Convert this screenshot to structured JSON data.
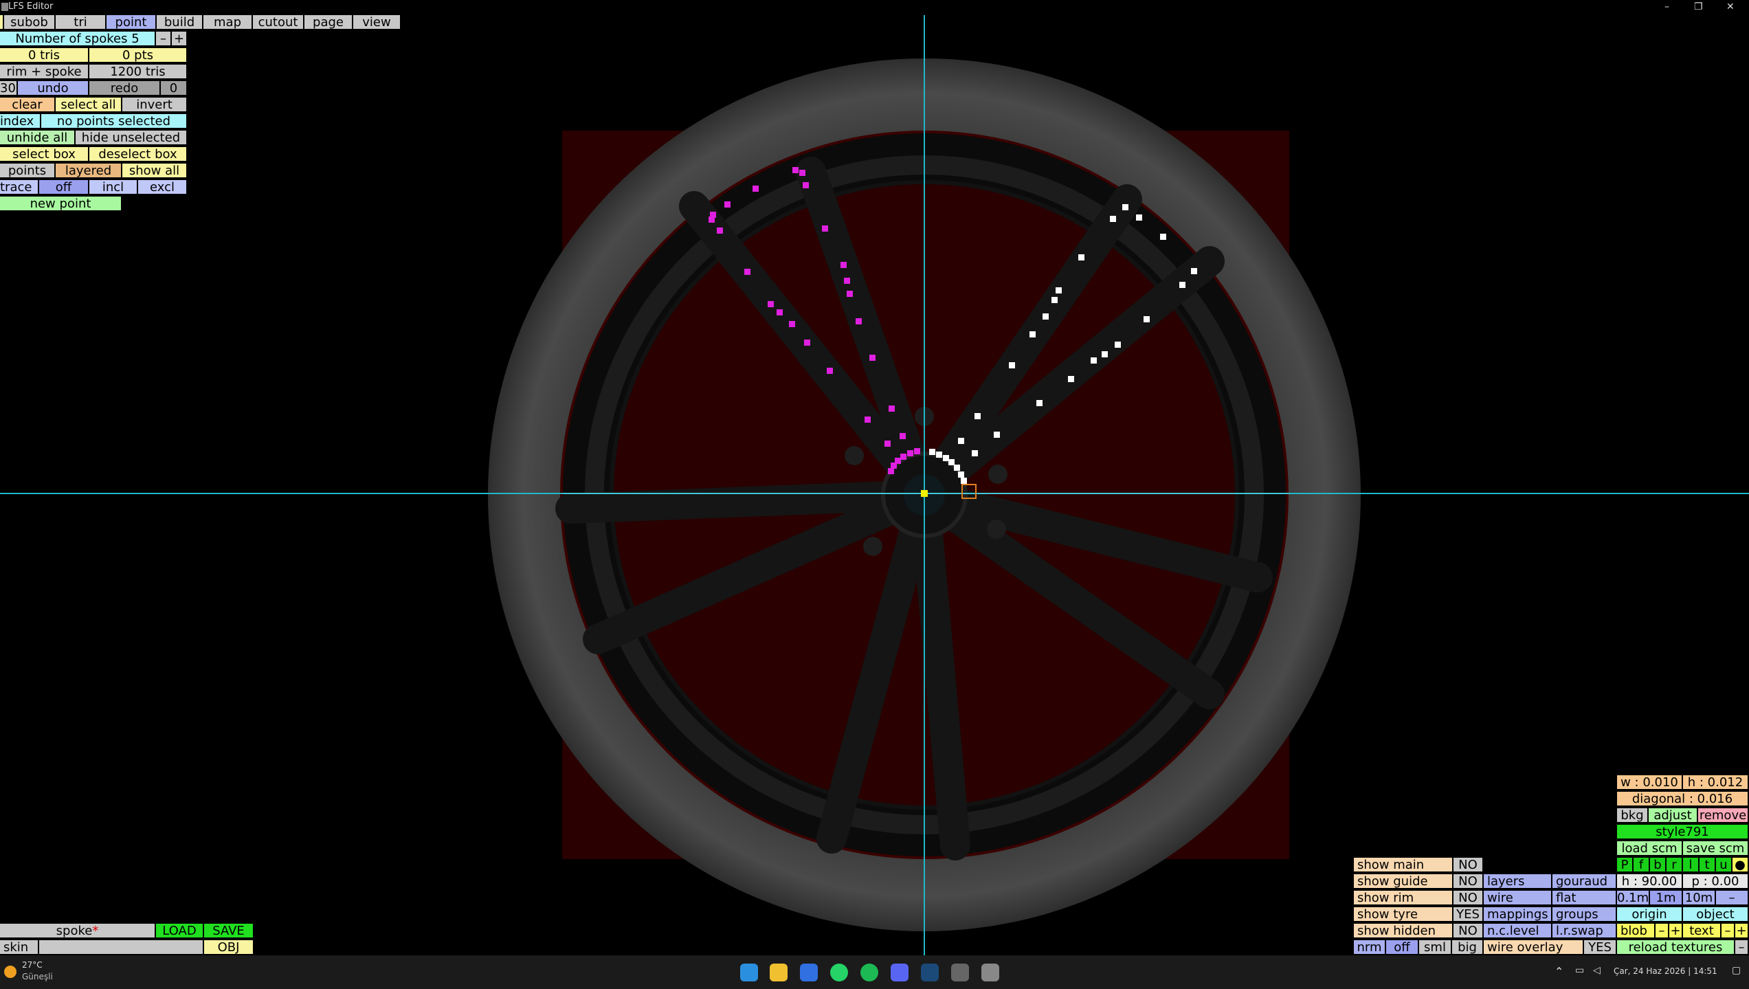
{
  "window": {
    "title": "LFS Editor",
    "controls": [
      "–",
      "❐",
      "✕"
    ]
  },
  "menu": [
    "subob",
    "tri",
    "point",
    "build",
    "map",
    "cutout",
    "page",
    "view"
  ],
  "left_panel": {
    "spokes_label": "Number of spokes 5",
    "spokes_minus": "–",
    "spokes_plus": "+",
    "tris": "0 tris",
    "pts": "0 pts",
    "rim_spoke": "rim + spoke",
    "total_tris": "1200 tris",
    "angle": "30",
    "undo": "undo",
    "redo": "redo",
    "redo_count": "0",
    "clear": "clear",
    "select_all": "select all",
    "invert": "invert",
    "index": "index",
    "no_points": "no points selected",
    "unhide_all": "unhide all",
    "hide_unselected": "hide unselected",
    "select_box": "select box",
    "deselect_box": "deselect box",
    "points": "points",
    "layered": "layered",
    "show_all": "show all",
    "trace": "trace",
    "off": "off",
    "incl": "incl",
    "excl": "excl",
    "new_point": "new point"
  },
  "bottom_left": {
    "spoke": "spoke",
    "spoke_mark": "*",
    "load": "LOAD",
    "save": "SAVE",
    "skin": "skin",
    "obj": "OBJ"
  },
  "right_panel": {
    "w": "w : 0.010",
    "h": "h : 0.012",
    "diagonal": "diagonal : 0.016",
    "bkg": "bkg",
    "adjust": "adjust",
    "remove": "remove",
    "style": "style791",
    "load_scm": "load scm",
    "save_scm": "save scm",
    "letters": [
      "P",
      "f",
      "b",
      "r",
      "l",
      "t",
      "u",
      "●"
    ],
    "h_val": "h : 90.00",
    "p_val": "p : 0.00",
    "show_main": "show main",
    "show_main_v": "NO",
    "show_guide": "show guide",
    "show_guide_v": "NO",
    "show_rim": "show rim",
    "show_rim_v": "NO",
    "show_tyre": "show tyre",
    "show_tyre_v": "YES",
    "show_hidden": "show hidden",
    "show_hidden_v": "NO",
    "layers": "layers",
    "gouraud": "gouraud",
    "wire": "wire",
    "flat": "flat",
    "mappings": "mappings",
    "groups": "groups",
    "nclevel": "n.c.level",
    "lrswap": "l.r.swap",
    "nrm": "nrm",
    "off": "off",
    "sml": "sml",
    "big": "big",
    "wire_overlay": "wire overlay",
    "wire_overlay_v": "YES",
    "zoom1": "0.1m",
    "zoom2": "1m",
    "zoom3": "10m",
    "zoom_minus": "–",
    "origin": "origin",
    "object": "object",
    "blob": "blob",
    "blob_minus": "–",
    "blob_plus": "+",
    "text": "text",
    "text_minus": "–",
    "text_plus": "+",
    "reload": "reload textures",
    "reload_minus": "–"
  },
  "taskbar": {
    "temp": "27°C",
    "weather": "Güneşli",
    "datetime": "Çar, 24 Haz 2026 | 14:51"
  },
  "colors": {
    "guide": "#20b8c8",
    "selected_points": "#e020e0",
    "points": "#ffffff",
    "bg_square": "#2a0000"
  }
}
